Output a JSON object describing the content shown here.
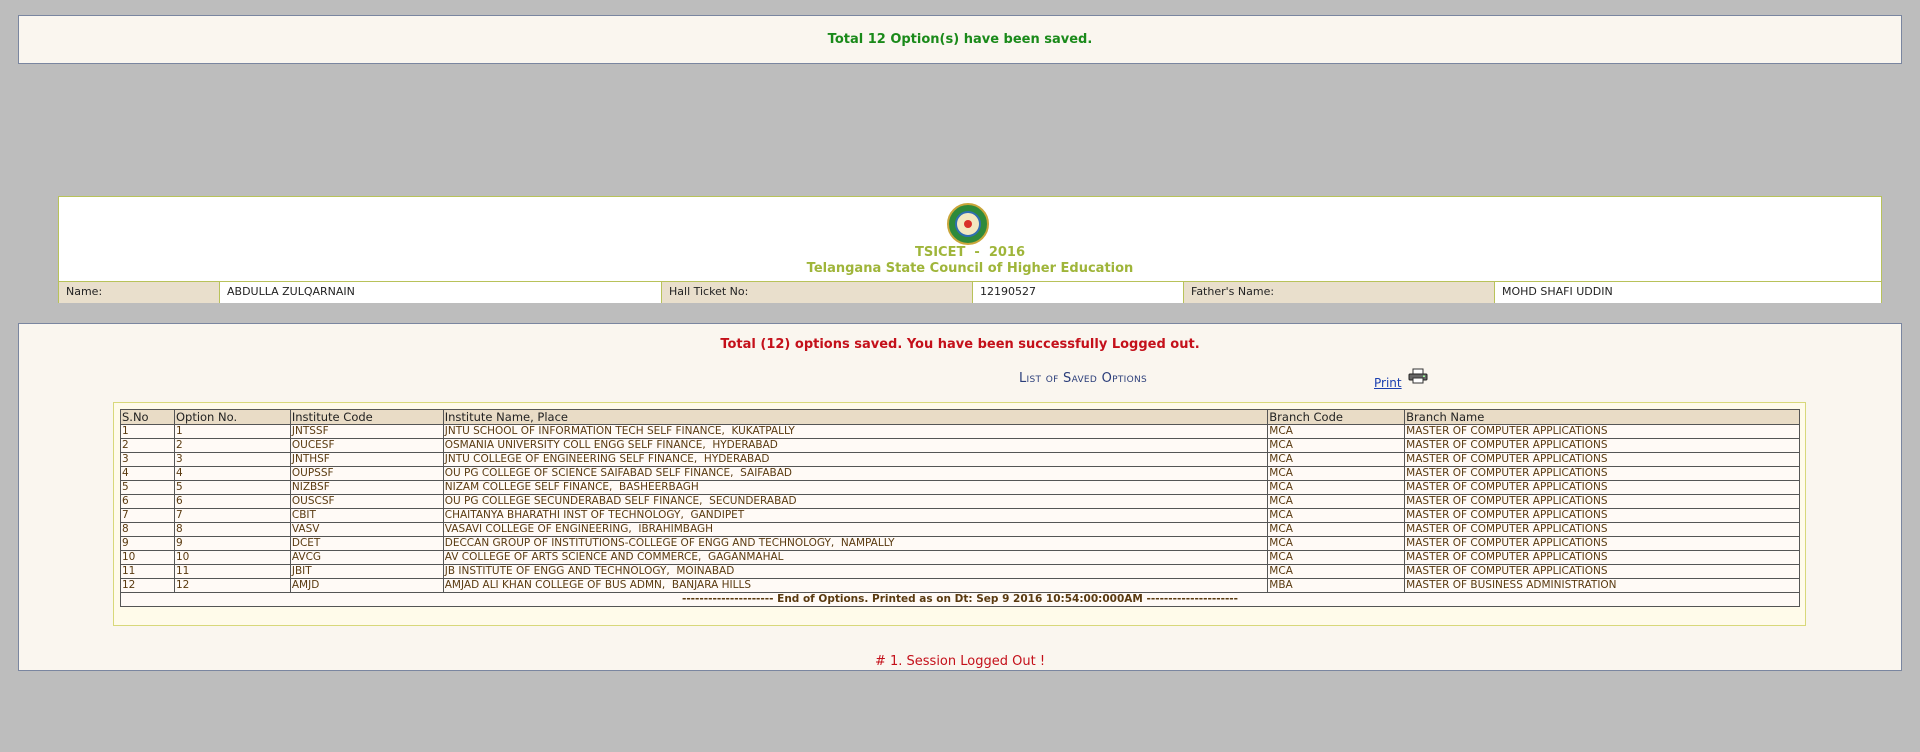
{
  "top_message": "Total 12 Option(s) have been saved.",
  "header": {
    "exam_title": "TSICET  -  2016",
    "council": "Telangana State Council of Higher Education",
    "name_label": "Name:",
    "name_value": "ABDULLA ZULQARNAIN",
    "hall_ticket_label": "Hall Ticket No:",
    "hall_ticket_value": "12190527",
    "father_label": "Father's Name:",
    "father_value": "MOHD SHAFI UDDIN"
  },
  "main": {
    "logout_message": "Total (12) options saved. You have been successfully Logged out.",
    "list_title": "List of Saved Options",
    "print_label": "Print",
    "printer_icon": "printer-icon",
    "columns": [
      "S.No",
      "Option No.",
      "Institute Code",
      "Institute Name, Place",
      "Branch Code",
      "Branch Name"
    ],
    "rows": [
      [
        "1",
        "1",
        "JNTSSF",
        "JNTU SCHOOL OF INFORMATION TECH SELF FINANCE,  KUKATPALLY",
        "MCA",
        "MASTER OF COMPUTER APPLICATIONS"
      ],
      [
        "2",
        "2",
        "OUCESF",
        "OSMANIA UNIVERSITY COLL ENGG SELF FINANCE,  HYDERABAD",
        "MCA",
        "MASTER OF COMPUTER APPLICATIONS"
      ],
      [
        "3",
        "3",
        "JNTHSF",
        "JNTU COLLEGE OF ENGINEERING SELF FINANCE,  HYDERABAD",
        "MCA",
        "MASTER OF COMPUTER APPLICATIONS"
      ],
      [
        "4",
        "4",
        "OUPSSF",
        "OU PG COLLEGE OF SCIENCE SAIFABAD SELF FINANCE,  SAIFABAD",
        "MCA",
        "MASTER OF COMPUTER APPLICATIONS"
      ],
      [
        "5",
        "5",
        "NIZBSF",
        "NIZAM COLLEGE SELF FINANCE,  BASHEERBAGH",
        "MCA",
        "MASTER OF COMPUTER APPLICATIONS"
      ],
      [
        "6",
        "6",
        "OUSCSF",
        "OU PG COLLEGE SECUNDERABAD SELF FINANCE,  SECUNDERABAD",
        "MCA",
        "MASTER OF COMPUTER APPLICATIONS"
      ],
      [
        "7",
        "7",
        "CBIT",
        "CHAITANYA BHARATHI INST OF TECHNOLOGY,  GANDIPET",
        "MCA",
        "MASTER OF COMPUTER APPLICATIONS"
      ],
      [
        "8",
        "8",
        "VASV",
        "VASAVI COLLEGE OF ENGINEERING,  IBRAHIMBAGH",
        "MCA",
        "MASTER OF COMPUTER APPLICATIONS"
      ],
      [
        "9",
        "9",
        "DCET",
        "DECCAN GROUP OF INSTITUTIONS-COLLEGE OF ENGG AND TECHNOLOGY,  NAMPALLY",
        "MCA",
        "MASTER OF COMPUTER APPLICATIONS"
      ],
      [
        "10",
        "10",
        "AVCG",
        "AV COLLEGE OF ARTS SCIENCE AND COMMERCE,  GAGANMAHAL",
        "MCA",
        "MASTER OF COMPUTER APPLICATIONS"
      ],
      [
        "11",
        "11",
        "JBIT",
        "JB INSTITUTE OF ENGG AND TECHNOLOGY,  MOINABAD",
        "MCA",
        "MASTER OF COMPUTER APPLICATIONS"
      ],
      [
        "12",
        "12",
        "AMJD",
        "AMJAD ALI KHAN COLLEGE OF BUS ADMN,  BANJARA HILLS",
        "MBA",
        "MASTER OF BUSINESS ADMINISTRATION"
      ]
    ],
    "end_text": "--------------------- End of Options. Printed as on Dt: Sep 9 2016 10:54:00:000AM ---------------------"
  },
  "session_message": "# 1. Session Logged Out !"
}
